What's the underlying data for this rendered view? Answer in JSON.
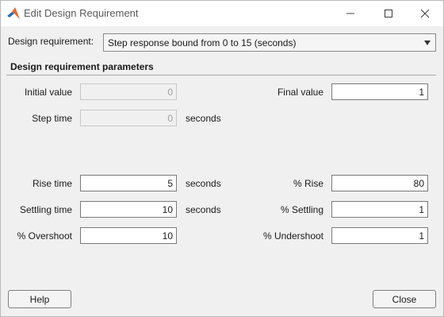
{
  "window": {
    "title": "Edit Design Requirement",
    "icon": "matlab-logo-icon",
    "controls": [
      "minimize-icon",
      "maximize-icon",
      "close-icon"
    ]
  },
  "requirement": {
    "label": "Design requirement:",
    "selected": "Step response bound from 0 to 15 (seconds)"
  },
  "params": {
    "section_title": "Design requirement parameters",
    "initial_value": {
      "label": "Initial value",
      "value": "0",
      "enabled": false
    },
    "step_time": {
      "label": "Step time",
      "value": "0",
      "unit": "seconds",
      "enabled": false
    },
    "final_value": {
      "label": "Final value",
      "value": "1"
    },
    "rise_time": {
      "label": "Rise time",
      "value": "5",
      "unit": "seconds"
    },
    "settling_time": {
      "label": "Settling time",
      "value": "10",
      "unit": "seconds"
    },
    "overshoot": {
      "label": "% Overshoot",
      "value": "10"
    },
    "pct_rise": {
      "label": "% Rise",
      "value": "80"
    },
    "pct_settling": {
      "label": "% Settling",
      "value": "1"
    },
    "undershoot": {
      "label": "% Undershoot",
      "value": "1"
    }
  },
  "buttons": {
    "help": "Help",
    "close": "Close"
  }
}
